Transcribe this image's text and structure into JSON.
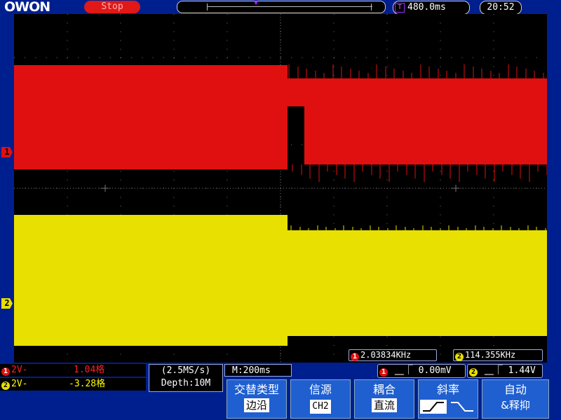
{
  "brand": {
    "logo": "OWON"
  },
  "status": {
    "run_state": "Stop"
  },
  "timebase_display": {
    "icon": "T",
    "value": "480.0ms"
  },
  "clock": "20:52",
  "channel_markers": {
    "ch1": "1",
    "ch2": "2"
  },
  "frequency": {
    "ch1": {
      "num": "1",
      "value": "2.03834KHz"
    },
    "ch2": {
      "num": "2",
      "value": "114.355KHz"
    }
  },
  "channels": [
    {
      "num": "1",
      "scale": "2V-",
      "position": "1.04格",
      "color": "#ff2020"
    },
    {
      "num": "2",
      "scale": "2V-",
      "position": "-3.28格",
      "color": "#ffff00"
    }
  ],
  "sampling": {
    "rate": "(2.5MS/s)",
    "depth": "Depth:10M"
  },
  "horizontal": {
    "main": "M:200ms"
  },
  "trigger": [
    {
      "num": "1",
      "slope": "⎽⎾",
      "level": "0.00mV"
    },
    {
      "num": "2",
      "slope": "⎽⎾",
      "level": "1.44V"
    }
  ],
  "menu": [
    {
      "title": "交替类型",
      "value": "边沿"
    },
    {
      "title": "信源",
      "value": "CH2"
    },
    {
      "title": "耦合",
      "value": "直流"
    },
    {
      "title": "斜率",
      "value": ""
    },
    {
      "title": "自动",
      "value": "&释抑"
    }
  ],
  "colors": {
    "ch1": "#e01010",
    "ch2": "#e8e000",
    "background": "#001f8f",
    "screen": "#000000"
  }
}
